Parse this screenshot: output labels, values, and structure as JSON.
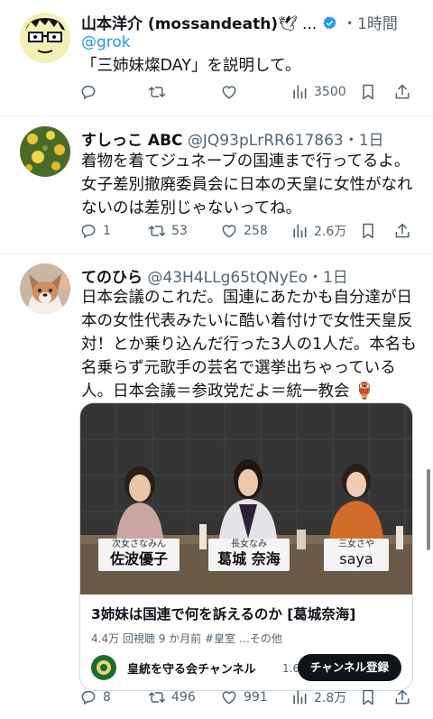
{
  "posts": [
    {
      "name": "山本洋介 (mossandeath)",
      "name_suffix": "🕊 ...",
      "time": "・1時間",
      "reply_to": "@grok",
      "text": "「三姉妹燦DAY」を説明して。",
      "stats": {
        "views": "3500"
      }
    },
    {
      "name": "すしっこ ABC",
      "handle": "@JQ93pLrRR617863・1日",
      "text": "着物を着てジュネーブの国連まで行ってるよ。女子差別撤廃委員会に日本の天皇に女性がなれないのは差別じゃないってね。",
      "stats": {
        "replies": "1",
        "reposts": "53",
        "likes": "258",
        "views": "2.6万"
      }
    },
    {
      "name": "てのひら",
      "handle": "@43H4LLg65tQNyEo・1日",
      "text": "日本会議のこれだ。国連にあたかも自分達が日本の女性代表みたいに酷い着付けで女性天皇反対！とか乗り込んだ行った3人の1人だ。本名も名乗らず元歌手の芸名で選挙出ちゃっている人。日本会議＝参政党だよ＝統一教会 🏺",
      "stats": {
        "replies": "8",
        "reposts": "496",
        "likes": "991",
        "views": "2.8万"
      }
    }
  ],
  "video": {
    "labels": [
      {
        "role": "次女さなみん",
        "name": "佐波優子"
      },
      {
        "role": "長女なみ",
        "name": "葛城 奈海"
      },
      {
        "role": "三女さや",
        "name": "saya"
      }
    ],
    "title": "3姉妹は国連で何を訴えるのか [葛城奈海]",
    "meta": "4.4万 回視聴  9 か月前  #皇室  …その他",
    "channel": "皇統を守る会チャンネル",
    "subs": "1.62万",
    "subscribe_label": "チャンネル登録"
  },
  "colors": {
    "text": "#0f1419",
    "secondary": "#536471",
    "verified": "#1d9bf0",
    "divider": "#eff3f4"
  }
}
